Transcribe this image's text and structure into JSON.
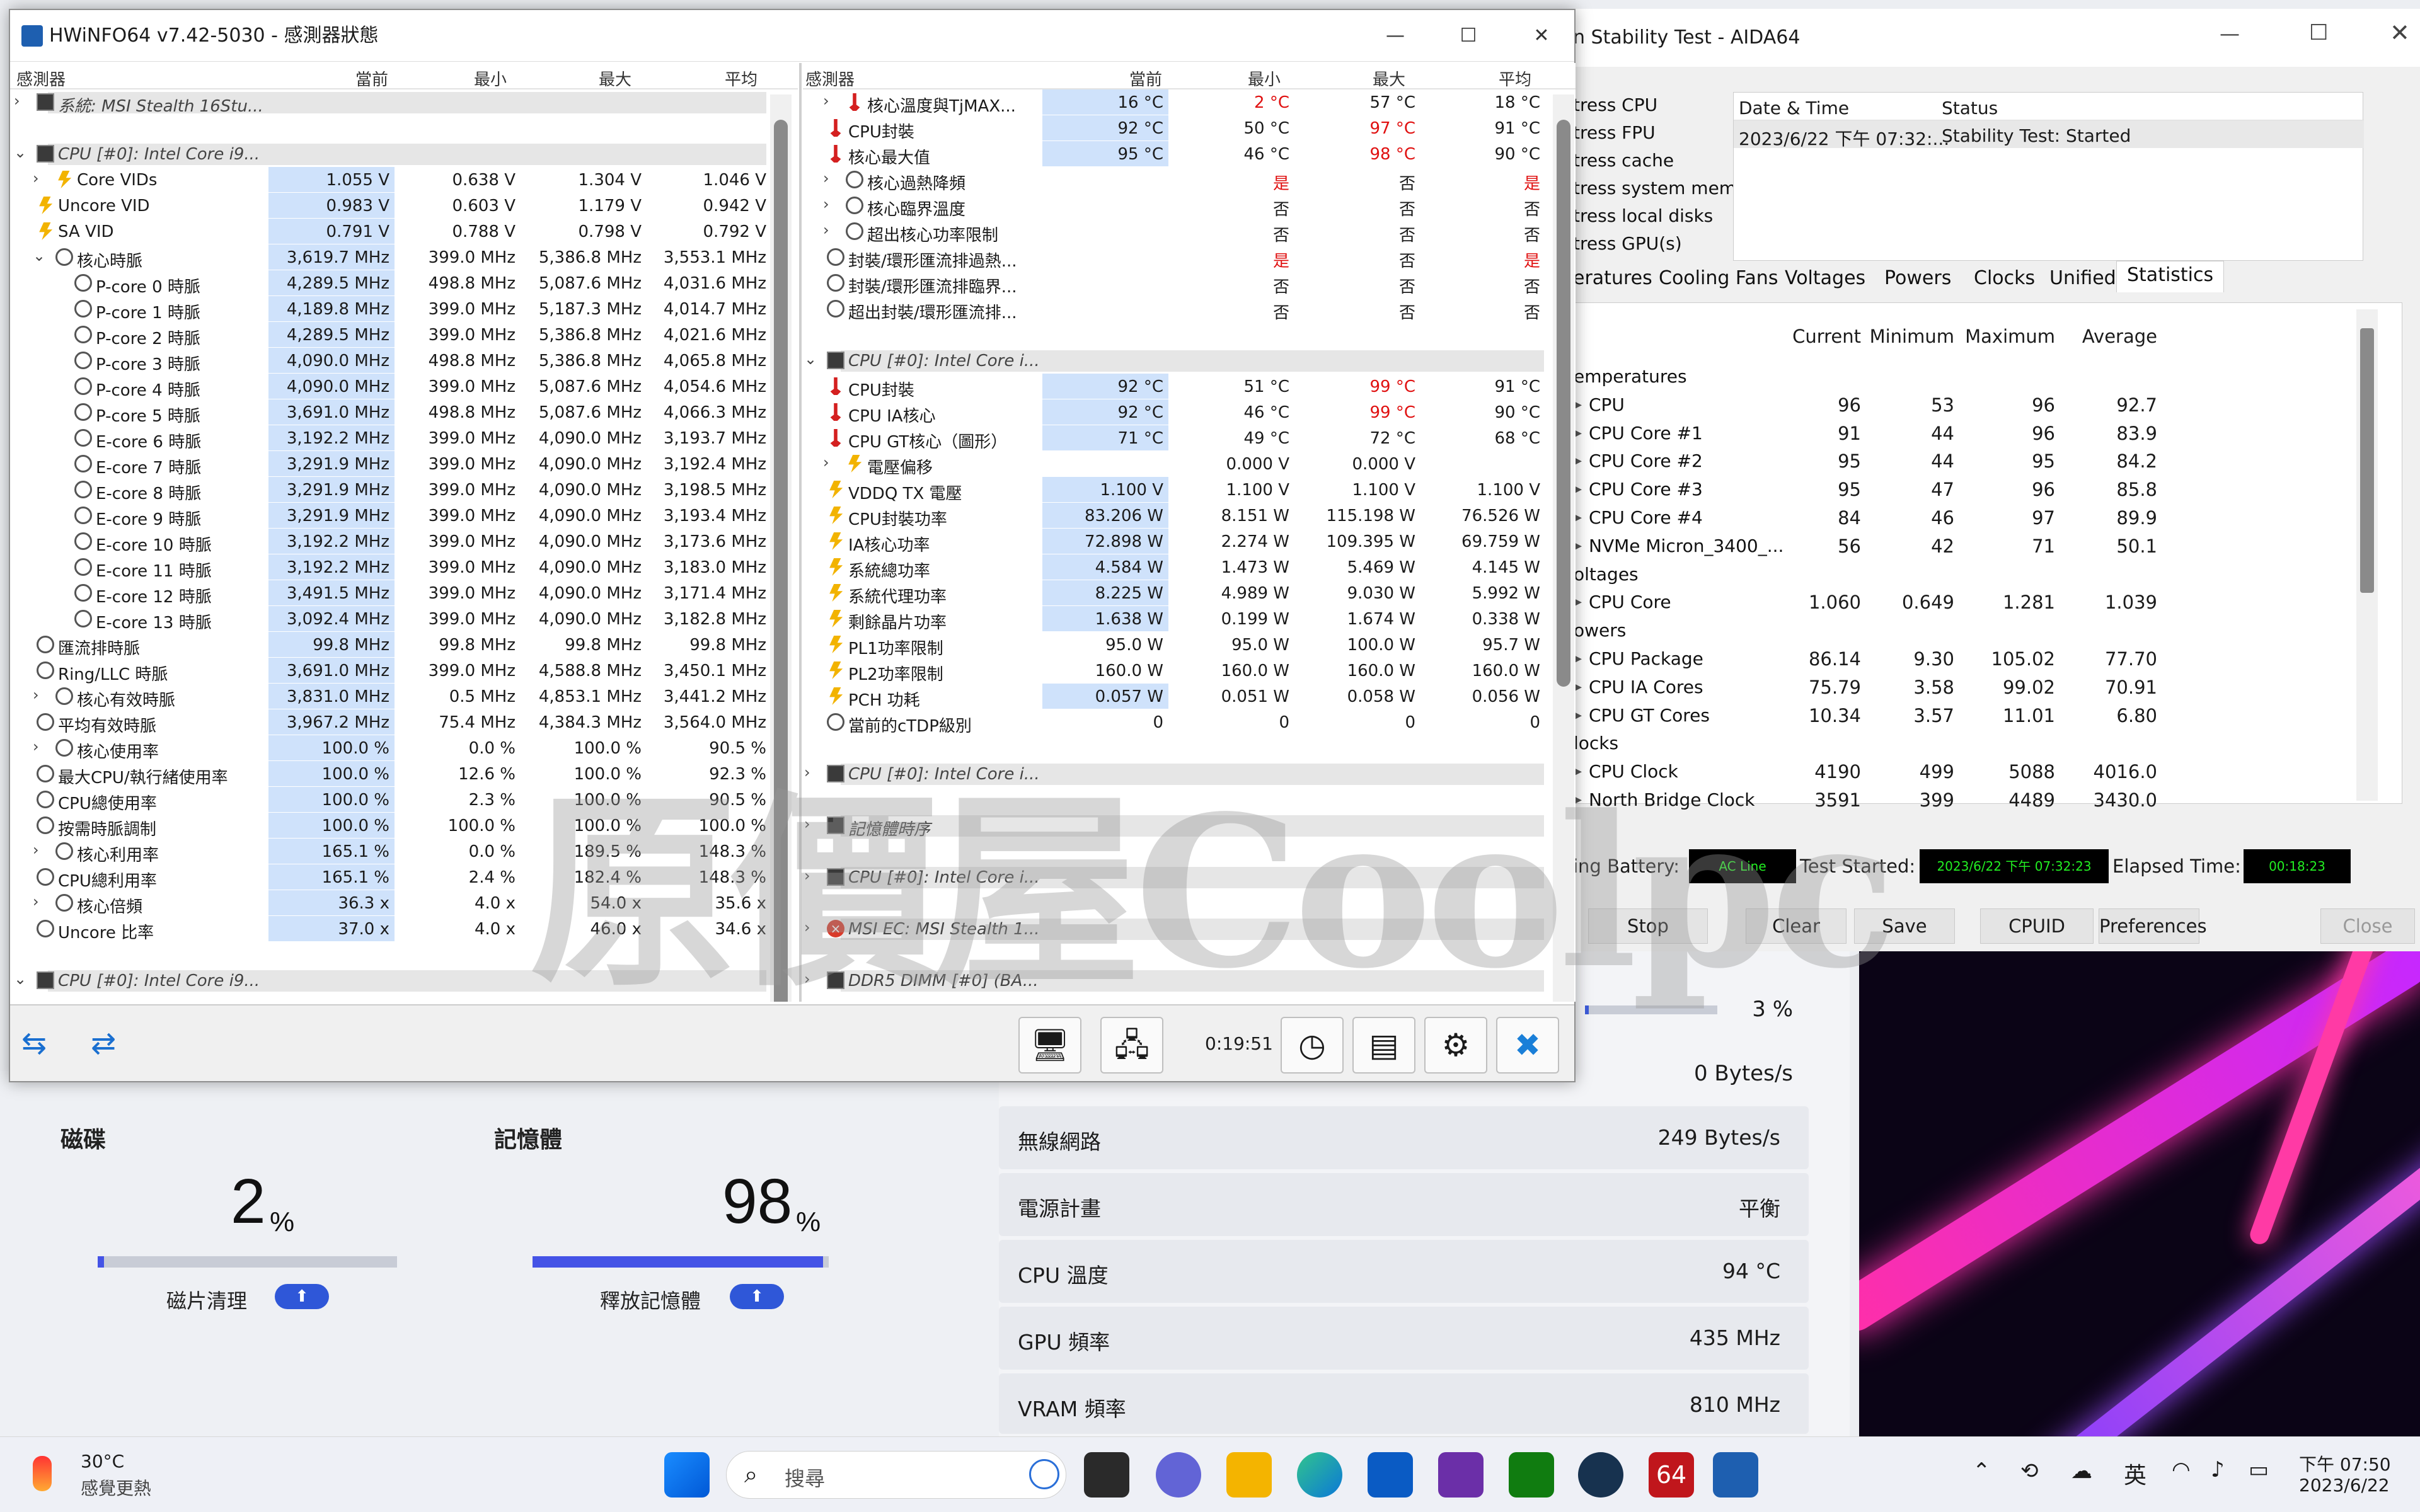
{
  "hwinfo": {
    "title": "HWiNFO64 v7.42-5030 - 感測器狀態",
    "headers": {
      "sensor": "感測器",
      "current": "當前",
      "min": "最小",
      "max": "最大",
      "avg": "平均"
    },
    "elapsed": "0:19:51",
    "left_rows": [
      {
        "e": ">",
        "i": "chip",
        "n": "系統: MSI Stealth 16Stu...",
        "g": true
      },
      {
        "e": "",
        "i": "",
        "n": ""
      },
      {
        "e": "v",
        "i": "chip",
        "n": "CPU [#0]: Intel Core i9...",
        "g": true
      },
      {
        "e": ">",
        "i": "bolt",
        "n": "Core VIDs",
        "v": [
          "1.055 V",
          "0.638 V",
          "1.304 V",
          "1.046 V"
        ],
        "ind": 1
      },
      {
        "e": "",
        "i": "bolt",
        "n": "Uncore VID",
        "v": [
          "0.983 V",
          "0.603 V",
          "1.179 V",
          "0.942 V"
        ]
      },
      {
        "e": "",
        "i": "bolt",
        "n": "SA VID",
        "v": [
          "0.791 V",
          "0.788 V",
          "0.798 V",
          "0.792 V"
        ]
      },
      {
        "e": "v",
        "i": "circ",
        "n": "核心時脈",
        "v": [
          "3,619.7 MHz",
          "399.0 MHz",
          "5,386.8 MHz",
          "3,553.1 MHz"
        ],
        "ind": 1
      },
      {
        "e": "",
        "i": "circ",
        "n": "P-core 0 時脈",
        "v": [
          "4,289.5 MHz",
          "498.8 MHz",
          "5,087.6 MHz",
          "4,031.6 MHz"
        ],
        "ind": 2
      },
      {
        "e": "",
        "i": "circ",
        "n": "P-core 1 時脈",
        "v": [
          "4,189.8 MHz",
          "399.0 MHz",
          "5,187.3 MHz",
          "4,014.7 MHz"
        ],
        "ind": 2
      },
      {
        "e": "",
        "i": "circ",
        "n": "P-core 2 時脈",
        "v": [
          "4,289.5 MHz",
          "399.0 MHz",
          "5,386.8 MHz",
          "4,021.6 MHz"
        ],
        "ind": 2
      },
      {
        "e": "",
        "i": "circ",
        "n": "P-core 3 時脈",
        "v": [
          "4,090.0 MHz",
          "498.8 MHz",
          "5,386.8 MHz",
          "4,065.8 MHz"
        ],
        "ind": 2
      },
      {
        "e": "",
        "i": "circ",
        "n": "P-core 4 時脈",
        "v": [
          "4,090.0 MHz",
          "399.0 MHz",
          "5,087.6 MHz",
          "4,054.6 MHz"
        ],
        "ind": 2
      },
      {
        "e": "",
        "i": "circ",
        "n": "P-core 5 時脈",
        "v": [
          "3,691.0 MHz",
          "498.8 MHz",
          "5,087.6 MHz",
          "4,066.3 MHz"
        ],
        "ind": 2
      },
      {
        "e": "",
        "i": "circ",
        "n": "E-core 6 時脈",
        "v": [
          "3,192.2 MHz",
          "399.0 MHz",
          "4,090.0 MHz",
          "3,193.7 MHz"
        ],
        "ind": 2
      },
      {
        "e": "",
        "i": "circ",
        "n": "E-core 7 時脈",
        "v": [
          "3,291.9 MHz",
          "399.0 MHz",
          "4,090.0 MHz",
          "3,192.4 MHz"
        ],
        "ind": 2
      },
      {
        "e": "",
        "i": "circ",
        "n": "E-core 8 時脈",
        "v": [
          "3,291.9 MHz",
          "399.0 MHz",
          "4,090.0 MHz",
          "3,198.5 MHz"
        ],
        "ind": 2
      },
      {
        "e": "",
        "i": "circ",
        "n": "E-core 9 時脈",
        "v": [
          "3,291.9 MHz",
          "399.0 MHz",
          "4,090.0 MHz",
          "3,193.4 MHz"
        ],
        "ind": 2
      },
      {
        "e": "",
        "i": "circ",
        "n": "E-core 10 時脈",
        "v": [
          "3,192.2 MHz",
          "399.0 MHz",
          "4,090.0 MHz",
          "3,173.6 MHz"
        ],
        "ind": 2
      },
      {
        "e": "",
        "i": "circ",
        "n": "E-core 11 時脈",
        "v": [
          "3,192.2 MHz",
          "399.0 MHz",
          "4,090.0 MHz",
          "3,183.0 MHz"
        ],
        "ind": 2
      },
      {
        "e": "",
        "i": "circ",
        "n": "E-core 12 時脈",
        "v": [
          "3,491.5 MHz",
          "399.0 MHz",
          "4,090.0 MHz",
          "3,171.4 MHz"
        ],
        "ind": 2
      },
      {
        "e": "",
        "i": "circ",
        "n": "E-core 13 時脈",
        "v": [
          "3,092.4 MHz",
          "399.0 MHz",
          "4,090.0 MHz",
          "3,182.8 MHz"
        ],
        "ind": 2
      },
      {
        "e": "",
        "i": "circ",
        "n": "匯流排時脈",
        "v": [
          "99.8 MHz",
          "99.8 MHz",
          "99.8 MHz",
          "99.8 MHz"
        ]
      },
      {
        "e": "",
        "i": "circ",
        "n": "Ring/LLC 時脈",
        "v": [
          "3,691.0 MHz",
          "399.0 MHz",
          "4,588.8 MHz",
          "3,450.1 MHz"
        ]
      },
      {
        "e": ">",
        "i": "circ",
        "n": "核心有效時脈",
        "v": [
          "3,831.0 MHz",
          "0.5 MHz",
          "4,853.1 MHz",
          "3,441.2 MHz"
        ],
        "ind": 1
      },
      {
        "e": "",
        "i": "circ",
        "n": "平均有效時脈",
        "v": [
          "3,967.2 MHz",
          "75.4 MHz",
          "4,384.3 MHz",
          "3,564.0 MHz"
        ]
      },
      {
        "e": ">",
        "i": "circ",
        "n": "核心使用率",
        "v": [
          "100.0 %",
          "0.0 %",
          "100.0 %",
          "90.5 %"
        ],
        "ind": 1
      },
      {
        "e": "",
        "i": "circ",
        "n": "最大CPU/執行緒使用率",
        "v": [
          "100.0 %",
          "12.6 %",
          "100.0 %",
          "92.3 %"
        ]
      },
      {
        "e": "",
        "i": "circ",
        "n": "CPU總使用率",
        "v": [
          "100.0 %",
          "2.3 %",
          "100.0 %",
          "90.5 %"
        ]
      },
      {
        "e": "",
        "i": "circ",
        "n": "按需時脈調制",
        "v": [
          "100.0 %",
          "100.0 %",
          "100.0 %",
          "100.0 %"
        ]
      },
      {
        "e": ">",
        "i": "circ",
        "n": "核心利用率",
        "v": [
          "165.1 %",
          "0.0 %",
          "189.5 %",
          "148.3 %"
        ],
        "ind": 1
      },
      {
        "e": "",
        "i": "circ",
        "n": "CPU總利用率",
        "v": [
          "165.1 %",
          "2.4 %",
          "182.4 %",
          "148.3 %"
        ]
      },
      {
        "e": ">",
        "i": "circ",
        "n": "核心倍頻",
        "v": [
          "36.3 x",
          "4.0 x",
          "54.0 x",
          "35.6 x"
        ],
        "ind": 1
      },
      {
        "e": "",
        "i": "circ",
        "n": "Uncore 比率",
        "v": [
          "37.0 x",
          "4.0 x",
          "46.0 x",
          "34.6 x"
        ]
      },
      {
        "e": "",
        "i": "",
        "n": ""
      },
      {
        "e": "v",
        "i": "chip",
        "n": "CPU [#0]: Intel Core i9...",
        "g": true
      }
    ],
    "right_rows": [
      {
        "e": ">",
        "i": "therm",
        "n": "核心溫度與TjMAX...",
        "v": [
          "16 °C",
          "2 °C",
          "57 °C",
          "18 °C"
        ],
        "r": [
          1
        ],
        "ind": 1
      },
      {
        "e": "",
        "i": "therm",
        "n": "CPU封裝",
        "v": [
          "92 °C",
          "50 °C",
          "97 °C",
          "91 °C"
        ],
        "r": [
          2
        ]
      },
      {
        "e": "",
        "i": "therm",
        "n": "核心最大值",
        "v": [
          "95 °C",
          "46 °C",
          "98 °C",
          "90 °C"
        ],
        "r": [
          2
        ]
      },
      {
        "e": ">",
        "i": "circ",
        "n": "核心過熱降頻",
        "v": [
          "",
          "是",
          "否",
          "是"
        ],
        "r": [
          1,
          3
        ],
        "ind": 1,
        "nc": true
      },
      {
        "e": ">",
        "i": "circ",
        "n": "核心臨界溫度",
        "v": [
          "",
          "否",
          "否",
          "否"
        ],
        "ind": 1,
        "nc": true
      },
      {
        "e": ">",
        "i": "circ",
        "n": "超出核心功率限制",
        "v": [
          "",
          "否",
          "否",
          "否"
        ],
        "ind": 1,
        "nc": true
      },
      {
        "e": "",
        "i": "circ",
        "n": "封裝/環形匯流排過熱...",
        "v": [
          "",
          "是",
          "否",
          "是"
        ],
        "r": [
          1,
          3
        ],
        "nc": true
      },
      {
        "e": "",
        "i": "circ",
        "n": "封裝/環形匯流排臨界...",
        "v": [
          "",
          "否",
          "否",
          "否"
        ],
        "nc": true
      },
      {
        "e": "",
        "i": "circ",
        "n": "超出封裝/環形匯流排...",
        "v": [
          "",
          "否",
          "否",
          "否"
        ],
        "nc": true
      },
      {
        "e": "",
        "i": "",
        "n": ""
      },
      {
        "e": "v",
        "i": "chip",
        "n": "CPU [#0]: Intel Core i...",
        "g": true
      },
      {
        "e": "",
        "i": "therm",
        "n": "CPU封裝",
        "v": [
          "92 °C",
          "51 °C",
          "99 °C",
          "91 °C"
        ],
        "r": [
          2
        ]
      },
      {
        "e": "",
        "i": "therm",
        "n": "CPU IA核心",
        "v": [
          "92 °C",
          "46 °C",
          "99 °C",
          "90 °C"
        ],
        "r": [
          2
        ]
      },
      {
        "e": "",
        "i": "therm",
        "n": "CPU GT核心（圖形）",
        "v": [
          "71 °C",
          "49 °C",
          "72 °C",
          "68 °C"
        ]
      },
      {
        "e": ">",
        "i": "bolt",
        "n": "電壓偏移",
        "v": [
          "",
          "0.000 V",
          "0.000 V",
          ""
        ],
        "ind": 1,
        "nc": true
      },
      {
        "e": "",
        "i": "bolt",
        "n": "VDDQ TX 電壓",
        "v": [
          "1.100 V",
          "1.100 V",
          "1.100 V",
          "1.100 V"
        ]
      },
      {
        "e": "",
        "i": "bolt",
        "n": "CPU封裝功率",
        "v": [
          "83.206 W",
          "8.151 W",
          "115.198 W",
          "76.526 W"
        ]
      },
      {
        "e": "",
        "i": "bolt",
        "n": "IA核心功率",
        "v": [
          "72.898 W",
          "2.274 W",
          "109.395 W",
          "69.759 W"
        ]
      },
      {
        "e": "",
        "i": "bolt",
        "n": "系統總功率",
        "v": [
          "4.584 W",
          "1.473 W",
          "5.469 W",
          "4.145 W"
        ]
      },
      {
        "e": "",
        "i": "bolt",
        "n": "系統代理功率",
        "v": [
          "8.225 W",
          "4.989 W",
          "9.030 W",
          "5.992 W"
        ]
      },
      {
        "e": "",
        "i": "bolt",
        "n": "剩餘晶片功率",
        "v": [
          "1.638 W",
          "0.199 W",
          "1.674 W",
          "0.338 W"
        ]
      },
      {
        "e": "",
        "i": "bolt",
        "n": "PL1功率限制",
        "v": [
          "95.0 W",
          "95.0 W",
          "100.0 W",
          "95.7 W"
        ],
        "nc": true
      },
      {
        "e": "",
        "i": "bolt",
        "n": "PL2功率限制",
        "v": [
          "160.0 W",
          "160.0 W",
          "160.0 W",
          "160.0 W"
        ],
        "nc": true
      },
      {
        "e": "",
        "i": "bolt",
        "n": "PCH 功耗",
        "v": [
          "0.057 W",
          "0.051 W",
          "0.058 W",
          "0.056 W"
        ]
      },
      {
        "e": "",
        "i": "circ",
        "n": "當前的cTDP級別",
        "v": [
          "0",
          "0",
          "0",
          "0"
        ],
        "nc": true
      },
      {
        "e": "",
        "i": "",
        "n": ""
      },
      {
        "e": ">",
        "i": "chip",
        "n": "CPU [#0]: Intel Core i...",
        "g": true
      },
      {
        "e": "",
        "i": "",
        "n": ""
      },
      {
        "e": ">",
        "i": "chip",
        "n": "記憶體時序",
        "g": true
      },
      {
        "e": "",
        "i": "",
        "n": ""
      },
      {
        "e": ">",
        "i": "chip",
        "n": "CPU [#0]: Intel Core i...",
        "g": true
      },
      {
        "e": "",
        "i": "",
        "n": ""
      },
      {
        "e": ">",
        "i": "errx",
        "n": "MSI EC: MSI Stealth 1...",
        "g": true
      },
      {
        "e": "",
        "i": "",
        "n": ""
      },
      {
        "e": ">",
        "i": "chip",
        "n": "DDR5 DIMM [#0] (BA...",
        "g": true
      }
    ]
  },
  "aida": {
    "title": "n Stability Test - AIDA64",
    "stress_items": [
      "tress CPU",
      "tress FPU",
      "tress cache",
      "tress system mem",
      "tress local disks",
      "tress GPU(s)"
    ],
    "log_headers": [
      "Date & Time",
      "Status"
    ],
    "log_row": [
      "2023/6/22 下午 07:32:...",
      "Stability Test: Started"
    ],
    "tabs": [
      "eratures",
      "Cooling Fans",
      "Voltages",
      "Powers",
      "Clocks",
      "Unified",
      "Statistics"
    ],
    "stat_headers": [
      "Current",
      "Minimum",
      "Maximum",
      "Average"
    ],
    "stats": [
      {
        "n": "emperatures",
        "h": true
      },
      {
        "n": "CPU",
        "v": [
          "96",
          "53",
          "96",
          "92.7"
        ]
      },
      {
        "n": "CPU Core #1",
        "v": [
          "91",
          "44",
          "96",
          "83.9"
        ]
      },
      {
        "n": "CPU Core #2",
        "v": [
          "95",
          "44",
          "95",
          "84.2"
        ]
      },
      {
        "n": "CPU Core #3",
        "v": [
          "95",
          "47",
          "96",
          "85.8"
        ]
      },
      {
        "n": "CPU Core #4",
        "v": [
          "84",
          "46",
          "97",
          "89.9"
        ]
      },
      {
        "n": "NVMe Micron_3400_...",
        "v": [
          "56",
          "42",
          "71",
          "50.1"
        ]
      },
      {
        "n": "oltages",
        "h": true
      },
      {
        "n": "CPU Core",
        "v": [
          "1.060",
          "0.649",
          "1.281",
          "1.039"
        ]
      },
      {
        "n": "owers",
        "h": true
      },
      {
        "n": "CPU Package",
        "v": [
          "86.14",
          "9.30",
          "105.02",
          "77.70"
        ]
      },
      {
        "n": "CPU IA Cores",
        "v": [
          "75.79",
          "3.58",
          "99.02",
          "70.91"
        ]
      },
      {
        "n": "CPU GT Cores",
        "v": [
          "10.34",
          "3.57",
          "11.01",
          "6.80"
        ]
      },
      {
        "n": "locks",
        "h": true
      },
      {
        "n": "CPU Clock",
        "v": [
          "4190",
          "499",
          "5088",
          "4016.0"
        ]
      },
      {
        "n": "North Bridge Clock",
        "v": [
          "3591",
          "399",
          "4489",
          "3430.0"
        ]
      }
    ],
    "battery_label": "ing Battery:",
    "battery_value": "AC Line",
    "started_label": "Test Started:",
    "started_value": "2023/6/22 下午 07:32:23",
    "elapsed_label": "Elapsed Time:",
    "elapsed_value": "00:18:23",
    "buttons": {
      "stop": "Stop",
      "clear": "Clear",
      "save": "Save",
      "cpuid": "CPUID",
      "prefs": "Preferences",
      "close": "Close"
    }
  },
  "dashboard": {
    "disk_title": "磁碟",
    "disk_value": "2",
    "disk_level": 0.02,
    "disk_action": "磁片清理",
    "mem_title": "記憶體",
    "mem_value": "98",
    "mem_level": 0.98,
    "mem_action": "釋放記憶體",
    "pct": "%",
    "top_pct": "3 %",
    "top_level": 0.03,
    "bytes_top": "0 Bytes/s",
    "rows": [
      {
        "k": "無線網路",
        "v": "249 Bytes/s"
      },
      {
        "k": "電源計畫",
        "v": "平衡"
      },
      {
        "k": "CPU 溫度",
        "v": "94 °C"
      },
      {
        "k": "GPU 頻率",
        "v": "435 MHz"
      },
      {
        "k": "VRAM 頻率",
        "v": "810 MHz"
      }
    ]
  },
  "taskbar": {
    "weather_temp": "30°C",
    "weather_desc": "感覺更熱",
    "search": "搜尋",
    "ime": "英",
    "time": "下午 07:50",
    "date": "2023/6/22"
  },
  "watermark": "原價屋Coolpc",
  "colors": {
    "accent": "#2f57d8",
    "highlight": "#cfe2fb",
    "alarm": "#e01010"
  }
}
